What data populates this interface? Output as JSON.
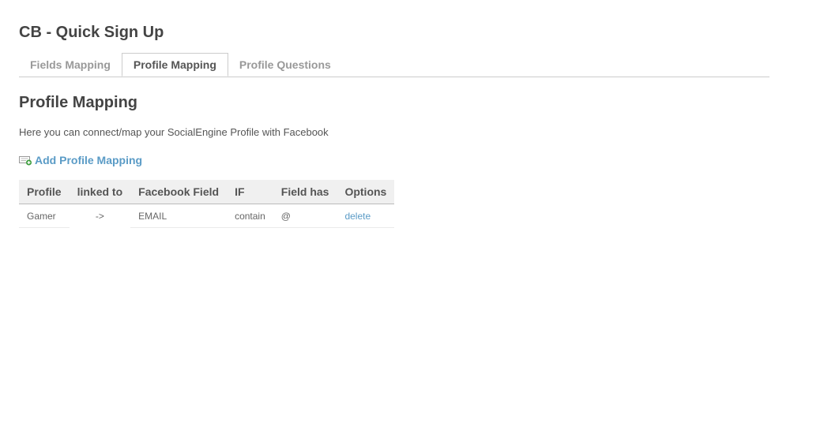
{
  "app": {
    "title": "CB - Quick Sign Up"
  },
  "tabs": [
    {
      "label": "Fields Mapping",
      "active": false
    },
    {
      "label": "Profile Mapping",
      "active": true
    },
    {
      "label": "Profile Questions",
      "active": false
    }
  ],
  "section": {
    "title": "Profile Mapping",
    "description": "Here you can connect/map your SocialEngine Profile with Facebook",
    "add_link": "Add Profile Mapping",
    "add_icon": "add-document-icon"
  },
  "table": {
    "headers": [
      "Profile",
      "linked to",
      "Facebook Field",
      "IF",
      "Field has",
      "Options"
    ],
    "rows": [
      {
        "profile": "Gamer",
        "linked_to": "->",
        "facebook_field": "EMAIL",
        "if": "contain",
        "field_has": "@",
        "option": "delete"
      }
    ]
  },
  "colors": {
    "link": "#5a9bc6",
    "header_bg": "#f0f0f0",
    "text": "#555555"
  }
}
